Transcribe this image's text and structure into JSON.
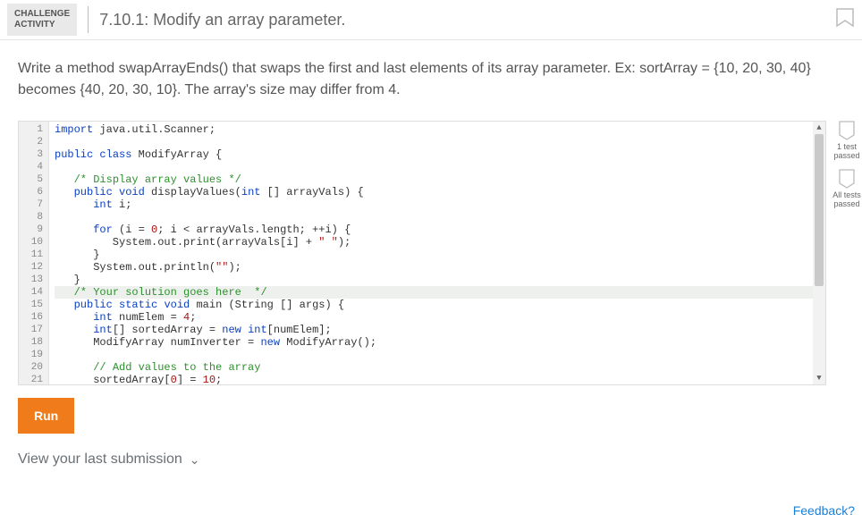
{
  "header": {
    "badge_line1": "CHALLENGE",
    "badge_line2": "ACTIVITY",
    "title": "7.10.1: Modify an array parameter."
  },
  "instructions": "Write a method swapArrayEnds() that swaps the first and last elements of its array parameter. Ex: sortArray = {10, 20, 30, 40} becomes {40, 20, 30, 10}. The array's size may differ from 4.",
  "results": {
    "one_test": "1 test\npassed",
    "all_tests": "All tests\npassed"
  },
  "code_lines": [
    {
      "n": 1,
      "hl": false,
      "tokens": [
        [
          "kw",
          "import"
        ],
        [
          "",
          " java.util.Scanner;"
        ]
      ]
    },
    {
      "n": 2,
      "hl": false,
      "tokens": []
    },
    {
      "n": 3,
      "hl": false,
      "tokens": [
        [
          "kw",
          "public"
        ],
        [
          "",
          " "
        ],
        [
          "kw",
          "class"
        ],
        [
          "",
          " ModifyArray {"
        ]
      ]
    },
    {
      "n": 4,
      "hl": false,
      "tokens": []
    },
    {
      "n": 5,
      "hl": false,
      "tokens": [
        [
          "",
          "   "
        ],
        [
          "cm",
          "/* Display array values */"
        ]
      ]
    },
    {
      "n": 6,
      "hl": false,
      "tokens": [
        [
          "",
          "   "
        ],
        [
          "kw",
          "public"
        ],
        [
          "",
          " "
        ],
        [
          "kw",
          "void"
        ],
        [
          "",
          " displayValues("
        ],
        [
          "ty",
          "int"
        ],
        [
          "",
          " [] arrayVals) {"
        ]
      ]
    },
    {
      "n": 7,
      "hl": false,
      "tokens": [
        [
          "",
          "      "
        ],
        [
          "ty",
          "int"
        ],
        [
          "",
          " i;"
        ]
      ]
    },
    {
      "n": 8,
      "hl": false,
      "tokens": []
    },
    {
      "n": 9,
      "hl": false,
      "tokens": [
        [
          "",
          "      "
        ],
        [
          "kw",
          "for"
        ],
        [
          "",
          " (i = "
        ],
        [
          "nm",
          "0"
        ],
        [
          "",
          "; i < arrayVals.length; ++i) {"
        ]
      ]
    },
    {
      "n": 10,
      "hl": false,
      "tokens": [
        [
          "",
          "         System.out.print(arrayVals[i] + "
        ],
        [
          "str",
          "\" \""
        ],
        [
          "",
          ");"
        ]
      ]
    },
    {
      "n": 11,
      "hl": false,
      "tokens": [
        [
          "",
          "      }"
        ]
      ]
    },
    {
      "n": 12,
      "hl": false,
      "tokens": [
        [
          "",
          "      System.out.println("
        ],
        [
          "str",
          "\"\""
        ],
        [
          "",
          ");"
        ]
      ]
    },
    {
      "n": 13,
      "hl": false,
      "tokens": [
        [
          "",
          "   }"
        ]
      ]
    },
    {
      "n": 14,
      "hl": true,
      "tokens": [
        [
          "",
          "   "
        ],
        [
          "cm",
          "/* Your solution goes here  */"
        ]
      ]
    },
    {
      "n": 15,
      "hl": false,
      "tokens": [
        [
          "",
          "   "
        ],
        [
          "kw",
          "public"
        ],
        [
          "",
          " "
        ],
        [
          "kw",
          "static"
        ],
        [
          "",
          " "
        ],
        [
          "kw",
          "void"
        ],
        [
          "",
          " main (String [] args) {"
        ]
      ]
    },
    {
      "n": 16,
      "hl": false,
      "tokens": [
        [
          "",
          "      "
        ],
        [
          "ty",
          "int"
        ],
        [
          "",
          " numElem = "
        ],
        [
          "nm",
          "4"
        ],
        [
          "",
          ";"
        ]
      ]
    },
    {
      "n": 17,
      "hl": false,
      "tokens": [
        [
          "",
          "      "
        ],
        [
          "ty",
          "int"
        ],
        [
          "",
          "[] sortedArray = "
        ],
        [
          "kw",
          "new"
        ],
        [
          "",
          " "
        ],
        [
          "ty",
          "int"
        ],
        [
          "",
          "[numElem];"
        ]
      ]
    },
    {
      "n": 18,
      "hl": false,
      "tokens": [
        [
          "",
          "      ModifyArray numInverter = "
        ],
        [
          "kw",
          "new"
        ],
        [
          "",
          " ModifyArray();"
        ]
      ]
    },
    {
      "n": 19,
      "hl": false,
      "tokens": []
    },
    {
      "n": 20,
      "hl": false,
      "tokens": [
        [
          "",
          "      "
        ],
        [
          "cm",
          "// Add values to the array"
        ]
      ]
    },
    {
      "n": 21,
      "hl": false,
      "tokens": [
        [
          "",
          "      sortedArray["
        ],
        [
          "nm",
          "0"
        ],
        [
          "",
          "] = "
        ],
        [
          "nm",
          "10"
        ],
        [
          "",
          ";"
        ]
      ]
    }
  ],
  "buttons": {
    "run": "Run",
    "last_submission": "View your last submission"
  },
  "footer": {
    "feedback": "Feedback?"
  }
}
